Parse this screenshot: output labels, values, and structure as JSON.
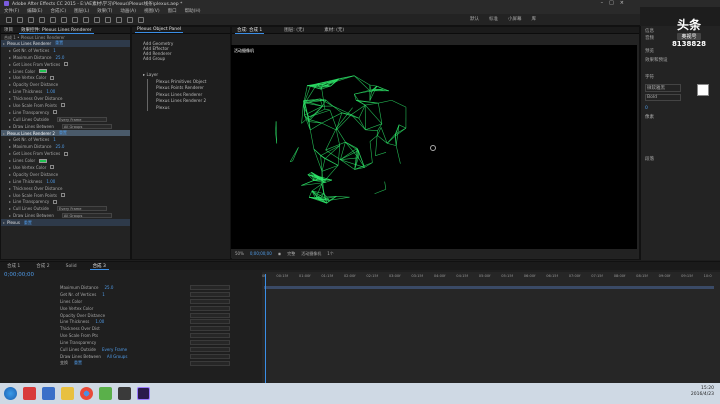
{
  "window": {
    "title": "Adobe After Effects CC 2015 - E:\\AE素材\\学习\\Plexus\\Plexus线条\\plexus.aep *",
    "min": "–",
    "max": "□",
    "close": "×"
  },
  "menu": [
    "文件(F)",
    "编辑(E)",
    "合成(C)",
    "图层(L)",
    "效果(T)",
    "动画(A)",
    "视图(V)",
    "窗口",
    "帮助(H)"
  ],
  "workspaces": [
    "默认",
    "标准",
    "小屏幕",
    "库"
  ],
  "effect_panel": {
    "tabs": [
      "项目",
      "效果控件: Plexus Lines Renderer"
    ],
    "comp": "合成 1 • Plexus Lines Renderer",
    "rows": [
      {
        "label": "Plexus Lines Renderer",
        "value": "重置",
        "kind": "head"
      },
      {
        "label": "Get Nr. of Vertices",
        "value": "1",
        "kind": "row"
      },
      {
        "label": "Maximum Distance",
        "value": "25.0",
        "kind": "row"
      },
      {
        "label": "Get Lines From Vertices",
        "value": "",
        "kind": "check"
      },
      {
        "label": "Lines Color",
        "value": "",
        "kind": "color"
      },
      {
        "label": "Use Vertex Color",
        "value": "",
        "kind": "check"
      },
      {
        "label": "Opacity Over Distance",
        "value": "",
        "kind": "row"
      },
      {
        "label": "Line Thickness",
        "value": "1.00",
        "kind": "row"
      },
      {
        "label": "Thickness Over Distance",
        "value": "",
        "kind": "row"
      },
      {
        "label": "Use Scale From Points",
        "value": "",
        "kind": "check"
      },
      {
        "label": "Line Transparency",
        "value": "",
        "kind": "check"
      },
      {
        "label": "Cull Lines Outside",
        "value": "Every Frame",
        "kind": "select"
      },
      {
        "label": "Draw Lines Between",
        "value": "All Groups",
        "kind": "select"
      },
      {
        "label": "Plexus Lines Renderer 2",
        "value": "重置",
        "kind": "headsel"
      },
      {
        "label": "Get Nr. of Vertices",
        "value": "1",
        "kind": "row"
      },
      {
        "label": "Maximum Distance",
        "value": "25.0",
        "kind": "row"
      },
      {
        "label": "Get Lines From Vertices",
        "value": "",
        "kind": "check"
      },
      {
        "label": "Lines Color",
        "value": "",
        "kind": "color"
      },
      {
        "label": "Use Vertex Color",
        "value": "",
        "kind": "check"
      },
      {
        "label": "Opacity Over Distance",
        "value": "",
        "kind": "row"
      },
      {
        "label": "Line Thickness",
        "value": "1.00",
        "kind": "row"
      },
      {
        "label": "Thickness Over Distance",
        "value": "",
        "kind": "row"
      },
      {
        "label": "Use Scale From Points",
        "value": "",
        "kind": "check"
      },
      {
        "label": "Line Transparency",
        "value": "",
        "kind": "check"
      },
      {
        "label": "Cull Lines Outside",
        "value": "Every Frame",
        "kind": "select"
      },
      {
        "label": "Draw Lines Between",
        "value": "All Groups",
        "kind": "select"
      },
      {
        "label": "Plexus",
        "value": "重置",
        "kind": "head"
      }
    ]
  },
  "plexus_menu": {
    "title": "Plexus Object Panel",
    "items": [
      "Add Geometry",
      "Add Effector",
      "Add Renderer",
      "Add Group"
    ]
  },
  "layers_tree": {
    "root": "Layer",
    "items": [
      "Plexus Primitives Object",
      "Plexus Points Renderer",
      "Plexus Lines Renderer",
      "Plexus Lines Renderer 2",
      "Plexus"
    ]
  },
  "viewer": {
    "tabs": [
      "合成: 合成 1",
      "图层: (无)",
      "素材: (无)"
    ],
    "comp_label": "活动摄像机",
    "zoom": "50%",
    "timecode": "0;00;00;00",
    "view": "完整",
    "camera": "活动摄像机",
    "views": "1个"
  },
  "right_panel": {
    "info": "信息",
    "audio": "音频",
    "preview": "预览",
    "effects": "效果和预设",
    "char": "字符",
    "para": "段落",
    "font": "微软雅黑",
    "size": "Bold",
    "tracking": "0",
    "unit": "像素"
  },
  "watermark": {
    "logo": "头条",
    "name": "奥视号",
    "id": "8138828"
  },
  "timeline": {
    "tabs": [
      "合成 1",
      "合成 2",
      "Solid",
      "合成 3"
    ],
    "timecode": "0;00;00;00",
    "ticks": [
      "0f",
      "00:15f",
      "01:00f",
      "01:15f",
      "02:00f",
      "02:15f",
      "03:00f",
      "03:15f",
      "04:00f",
      "04:15f",
      "05:00f",
      "05:15f",
      "06:00f",
      "06:15f",
      "07:00f",
      "07:15f",
      "08:00f",
      "08:15f",
      "09:00f",
      "09:15f",
      "10:0"
    ],
    "rows": [
      {
        "name": "Maximum Distance",
        "value": "25.0"
      },
      {
        "name": "Get Nr. of Vertices",
        "value": "1"
      },
      {
        "name": "Lines Color",
        "value": ""
      },
      {
        "name": "Use Vertex Color",
        "value": ""
      },
      {
        "name": "Opacity Over Distance",
        "value": ""
      },
      {
        "name": "Line Thickness",
        "value": "1.00"
      },
      {
        "name": "Thickness Over Dist",
        "value": ""
      },
      {
        "name": "Use Scale From Pts",
        "value": ""
      },
      {
        "name": "Line Transparency",
        "value": ""
      },
      {
        "name": "Cull Lines Outside",
        "value": "Every Frame"
      },
      {
        "name": "Draw Lines Between",
        "value": "All Groups"
      },
      {
        "name": "变换",
        "value": "重置"
      }
    ]
  },
  "taskbar": {
    "time": "15:20",
    "date": "2016/4/23"
  }
}
